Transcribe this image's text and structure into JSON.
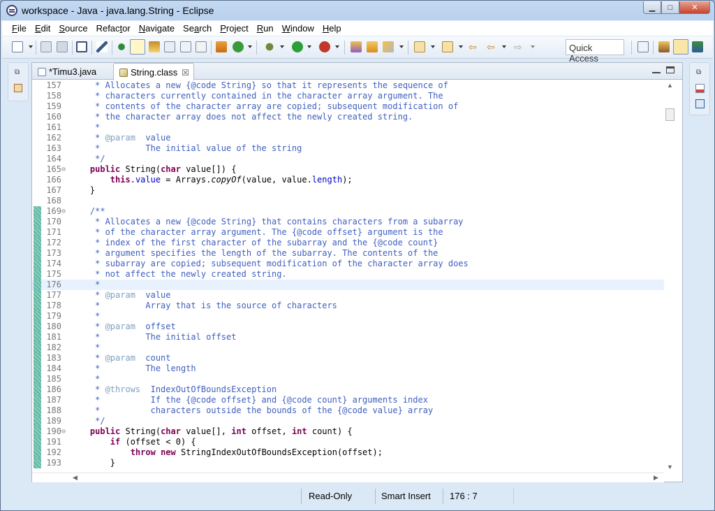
{
  "window": {
    "title": "workspace - Java - java.lang.String - Eclipse"
  },
  "menu": [
    {
      "mn": "F",
      "rest": "ile"
    },
    {
      "mn": "E",
      "rest": "dit"
    },
    {
      "mn": "S",
      "rest": "ource"
    },
    {
      "pre": "Refac",
      "mn": "t",
      "rest": "or"
    },
    {
      "mn": "N",
      "rest": "avigate"
    },
    {
      "pre": "Se",
      "mn": "a",
      "rest": "rch"
    },
    {
      "mn": "P",
      "rest": "roject"
    },
    {
      "mn": "R",
      "rest": "un"
    },
    {
      "mn": "W",
      "rest": "indow"
    },
    {
      "mn": "H",
      "rest": "elp"
    }
  ],
  "toolbar": {
    "quick_access": "Quick Access"
  },
  "tabs": [
    {
      "label": "*Timu3.java",
      "active": false
    },
    {
      "label": "String.class",
      "active": true,
      "close": "☒"
    }
  ],
  "editor": {
    "current_line": 176,
    "changed_ruler_lines": [
      169,
      193
    ],
    "lines": [
      {
        "n": 157,
        "fold": "",
        "html": "<span class=\"c\">     * Allocates a new {@code String} so that it represents the sequence of</span>"
      },
      {
        "n": 158,
        "fold": "",
        "html": "<span class=\"c\">     * characters currently contained in the character array argument. The</span>"
      },
      {
        "n": 159,
        "fold": "",
        "html": "<span class=\"c\">     * contents of the character array are copied; subsequent modification of</span>"
      },
      {
        "n": 160,
        "fold": "",
        "html": "<span class=\"c\">     * the character array does not affect the newly created string.</span>"
      },
      {
        "n": 161,
        "fold": "",
        "html": "<span class=\"c\">     *</span>"
      },
      {
        "n": 162,
        "fold": "",
        "html": "<span class=\"c\">     * <span class=\"tag\">@param</span>  value</span>"
      },
      {
        "n": 163,
        "fold": "",
        "html": "<span class=\"c\">     *         The initial value of the string</span>"
      },
      {
        "n": 164,
        "fold": "",
        "html": "<span class=\"c\">     */</span>"
      },
      {
        "n": 165,
        "fold": "⊖",
        "html": "    <span class=\"kw\">public</span> String(<span class=\"kw\">char</span> value[]) {"
      },
      {
        "n": 166,
        "fold": "",
        "html": "        <span class=\"kw\">this</span>.<span class=\"fld\">value</span> = Arrays.<span class=\"it\">copyOf</span>(value, value.<span class=\"fld\">length</span>);"
      },
      {
        "n": 167,
        "fold": "",
        "html": "    }"
      },
      {
        "n": 168,
        "fold": "",
        "html": ""
      },
      {
        "n": 169,
        "fold": "⊖",
        "html": "<span class=\"c\">    /**</span>"
      },
      {
        "n": 170,
        "fold": "",
        "html": "<span class=\"c\">     * Allocates a new {@code String} that contains characters from a subarray</span>"
      },
      {
        "n": 171,
        "fold": "",
        "html": "<span class=\"c\">     * of the character array argument. The {@code offset} argument is the</span>"
      },
      {
        "n": 172,
        "fold": "",
        "html": "<span class=\"c\">     * index of the first character of the subarray and the {@code count}</span>"
      },
      {
        "n": 173,
        "fold": "",
        "html": "<span class=\"c\">     * argument specifies the length of the subarray. The contents of the</span>"
      },
      {
        "n": 174,
        "fold": "",
        "html": "<span class=\"c\">     * subarray are copied; subsequent modification of the character array does</span>"
      },
      {
        "n": 175,
        "fold": "",
        "html": "<span class=\"c\">     * not affect the newly created string.</span>"
      },
      {
        "n": 176,
        "fold": "",
        "html": "<span class=\"c\">     *</span>"
      },
      {
        "n": 177,
        "fold": "",
        "html": "<span class=\"c\">     * <span class=\"tag\">@param</span>  value</span>"
      },
      {
        "n": 178,
        "fold": "",
        "html": "<span class=\"c\">     *         Array that is the source of characters</span>"
      },
      {
        "n": 179,
        "fold": "",
        "html": "<span class=\"c\">     *</span>"
      },
      {
        "n": 180,
        "fold": "",
        "html": "<span class=\"c\">     * <span class=\"tag\">@param</span>  offset</span>"
      },
      {
        "n": 181,
        "fold": "",
        "html": "<span class=\"c\">     *         The initial offset</span>"
      },
      {
        "n": 182,
        "fold": "",
        "html": "<span class=\"c\">     *</span>"
      },
      {
        "n": 183,
        "fold": "",
        "html": "<span class=\"c\">     * <span class=\"tag\">@param</span>  count</span>"
      },
      {
        "n": 184,
        "fold": "",
        "html": "<span class=\"c\">     *         The length</span>"
      },
      {
        "n": 185,
        "fold": "",
        "html": "<span class=\"c\">     *</span>"
      },
      {
        "n": 186,
        "fold": "",
        "html": "<span class=\"c\">     * <span class=\"tag\">@throws</span>  IndexOutOfBoundsException</span>"
      },
      {
        "n": 187,
        "fold": "",
        "html": "<span class=\"c\">     *          If the {@code offset} and {@code count} arguments index</span>"
      },
      {
        "n": 188,
        "fold": "",
        "html": "<span class=\"c\">     *          characters outside the bounds of the {@code value} array</span>"
      },
      {
        "n": 189,
        "fold": "",
        "html": "<span class=\"c\">     */</span>"
      },
      {
        "n": 190,
        "fold": "⊖",
        "html": "    <span class=\"kw\">public</span> String(<span class=\"kw\">char</span> value[], <span class=\"kw\">int</span> offset, <span class=\"kw\">int</span> count) {"
      },
      {
        "n": 191,
        "fold": "",
        "html": "        <span class=\"kw\">if</span> (offset &lt; 0) {"
      },
      {
        "n": 192,
        "fold": "",
        "html": "            <span class=\"kw\">throw</span> <span class=\"kw\">new</span> StringIndexOutOfBoundsException(offset);"
      },
      {
        "n": 193,
        "fold": "",
        "html": "        }"
      }
    ]
  },
  "status": {
    "mode": "Read-Only",
    "insert": "Smart Insert",
    "position": "176 : 7"
  },
  "colors": {
    "comment": "#3f5fbf",
    "keyword": "#7f0055",
    "field": "#0000c0",
    "current_line": "#e8f2fe",
    "change_ruler": "#5fb6a2"
  }
}
